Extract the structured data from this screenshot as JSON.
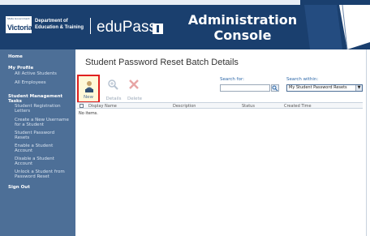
{
  "header": {
    "logo_small_text": "State Government",
    "logo_big_text": "Victoria",
    "department_line1": "Department of",
    "department_line2": "Education & Training",
    "brand": "eduPass",
    "console_title_line1": "Administration",
    "console_title_line2": "Console"
  },
  "sidebar": {
    "home": "Home",
    "my_profile": "My Profile",
    "profile_items": [
      "All Active Students",
      "All Employees"
    ],
    "student_mgmt_line1": "Student Management",
    "student_mgmt_line2": "Tasks",
    "task_items": [
      [
        "Student Registration",
        "Letters"
      ],
      [
        "Create a New Username",
        "for a Student"
      ],
      [
        "Student Password",
        "Resets"
      ],
      [
        "Enable a Student",
        "Account"
      ],
      [
        "Disable a Student",
        "Account"
      ],
      [
        "Unlock a Student from",
        "Password Reset"
      ]
    ],
    "sign_out": "Sign Out"
  },
  "main": {
    "title": "Student Password Reset Batch Details",
    "toolbar": {
      "new_label": "New",
      "details_label": "Details",
      "delete_label": "Delete"
    },
    "search": {
      "label": "Search for:",
      "value": "",
      "within_label": "Search within:",
      "within_selected": "My Student Password Resets"
    },
    "table": {
      "columns": [
        "Display Name",
        "Description",
        "Status",
        "Created Time"
      ],
      "empty_text": "No items."
    }
  }
}
